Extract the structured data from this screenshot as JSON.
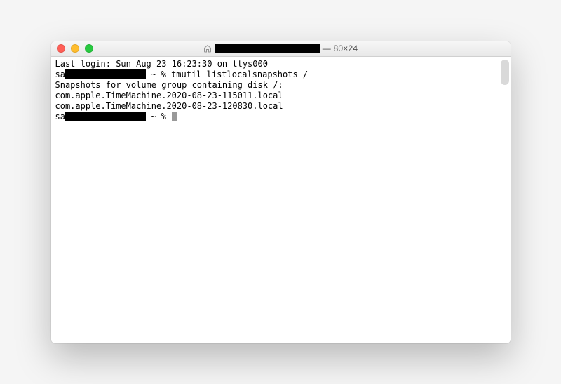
{
  "titlebar": {
    "dimensions": "— 80×24"
  },
  "terminal": {
    "last_login_prefix": "Last login: ",
    "last_login_value": "Sun Aug 23 16:23:30 on ttys000",
    "prompt_user_prefix": "sa",
    "prompt_suffix": " ~ % ",
    "command1": "tmutil listlocalsnapshots /",
    "output_header": "Snapshots for volume group containing disk /:",
    "snapshot1": "com.apple.TimeMachine.2020-08-23-115011.local",
    "snapshot2": "com.apple.TimeMachine.2020-08-23-120830.local"
  }
}
